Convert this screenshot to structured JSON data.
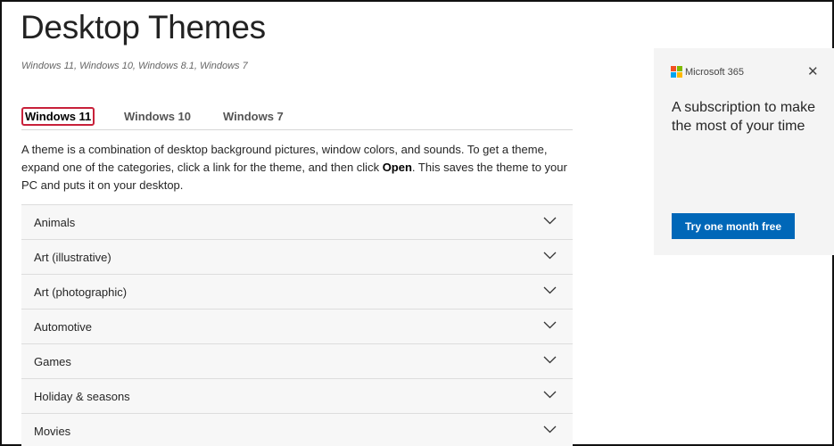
{
  "page": {
    "title": "Desktop Themes",
    "subtitle": "Windows 11, Windows 10, Windows 8.1, Windows 7"
  },
  "tabs": [
    {
      "label": "Windows 11",
      "active": true
    },
    {
      "label": "Windows 10"
    },
    {
      "label": "Windows 7"
    }
  ],
  "description": {
    "part1": "A theme is a combination of desktop background pictures, window colors, and sounds. To get a theme, expand one of the categories, click a link for the theme, and then click ",
    "bold": "Open",
    "part2": ". This saves the theme to your PC and puts it on your desktop."
  },
  "categories": [
    "Animals",
    "Art (illustrative)",
    "Art (photographic)",
    "Automotive",
    "Games",
    "Holiday & seasons",
    "Movies"
  ],
  "ad": {
    "brand": "Microsoft 365",
    "headline": "A subscription to make the most of your time",
    "button": "Try one month free",
    "accent": "#0067b8"
  }
}
